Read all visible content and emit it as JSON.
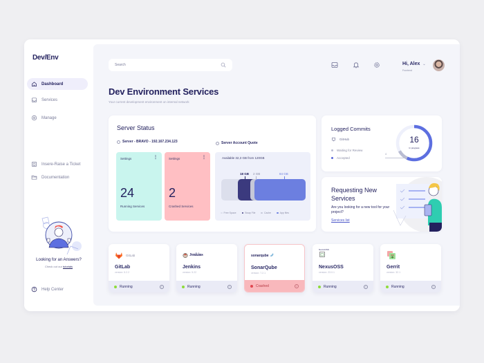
{
  "app": {
    "logo": "Dev/Env"
  },
  "sidebar": {
    "items": [
      {
        "label": "Dashboard",
        "icon": "home-icon",
        "active": true
      },
      {
        "label": "Services",
        "icon": "inbox-icon"
      },
      {
        "label": "Manage",
        "icon": "gear-icon"
      },
      {
        "label": "Insere-Raise a Ticket",
        "icon": "ticket-icon"
      },
      {
        "label": "Documentation",
        "icon": "folder-icon"
      }
    ],
    "help": {
      "title": "Looking for an Answers?",
      "sub_prefix": "Check out our",
      "link": "tutorials"
    },
    "help_center": "Help Center"
  },
  "header": {
    "search_placeholder": "Search",
    "user": {
      "greeting": "Hi, Alex",
      "role": "Frontend"
    }
  },
  "page": {
    "title": "Dev Environment Services",
    "subtitle": "Your current development environment on internal network"
  },
  "server_status": {
    "title": "Server Status",
    "server": "Server - BRAVO - 192.167.234.123",
    "running": {
      "header": "Settings",
      "count": "24",
      "label": "Running Services",
      "color": "#c9f5ee"
    },
    "crashed": {
      "header": "Settings",
      "count": "2",
      "label": "Crashed Services",
      "color": "#ffbfc3"
    },
    "quote": {
      "title": "Server Account Quote",
      "available": "Available 32,3 GB from 120GB",
      "segments": [
        {
          "name": "Free Space",
          "label": "",
          "color": "#dcdfec"
        },
        {
          "name": "Swap File",
          "label": "18 GB",
          "color": "#3b3a7e"
        },
        {
          "name": "Cache",
          "label": "2 GB",
          "color": "#c5c8d8"
        },
        {
          "name": "App Files",
          "label": "84 GB",
          "color": "#6c7fe0"
        }
      ],
      "legend": [
        "Free Space",
        "Swap File",
        "Cache",
        "App files"
      ]
    }
  },
  "commits": {
    "title": "Logged Commits",
    "source": "GitHub",
    "legend": [
      {
        "label": "Waiting for Review",
        "color": "#b9bcd2"
      },
      {
        "label": "Accepted",
        "color": "#5868d8"
      }
    ],
    "count": "16",
    "count_label": "In progress",
    "side_value": "4",
    "accepted_fraction": 0.57,
    "waiting_fraction": 0.1
  },
  "request": {
    "title": "Requesting New Services",
    "subtitle": "Are you looking for a new tool for your project?",
    "link": "Services list"
  },
  "services": [
    {
      "logo_text": "GitLab",
      "name": "GitLab",
      "version": "version: 5.2.2",
      "status": "Running",
      "status_color": "#8ddc3a"
    },
    {
      "logo_text": "Jenkins",
      "name": "Jenkins",
      "version": "version: 5.22",
      "status": "Running",
      "status_color": "#8ddc3a"
    },
    {
      "logo_text": "sonarqube",
      "name": "SonarQube",
      "version": "version: 7.2.1",
      "status": "Crashed",
      "status_color": "#e0474f"
    },
    {
      "logo_text": "NexusOSS",
      "name": "NexusOSS",
      "version": "version: 23.0.1",
      "status": "Running",
      "status_color": "#8ddc3a"
    },
    {
      "logo_text": "",
      "name": "Gerrit",
      "version": "version: 32.1",
      "status": "Running",
      "status_color": "#8ddc3a"
    }
  ]
}
